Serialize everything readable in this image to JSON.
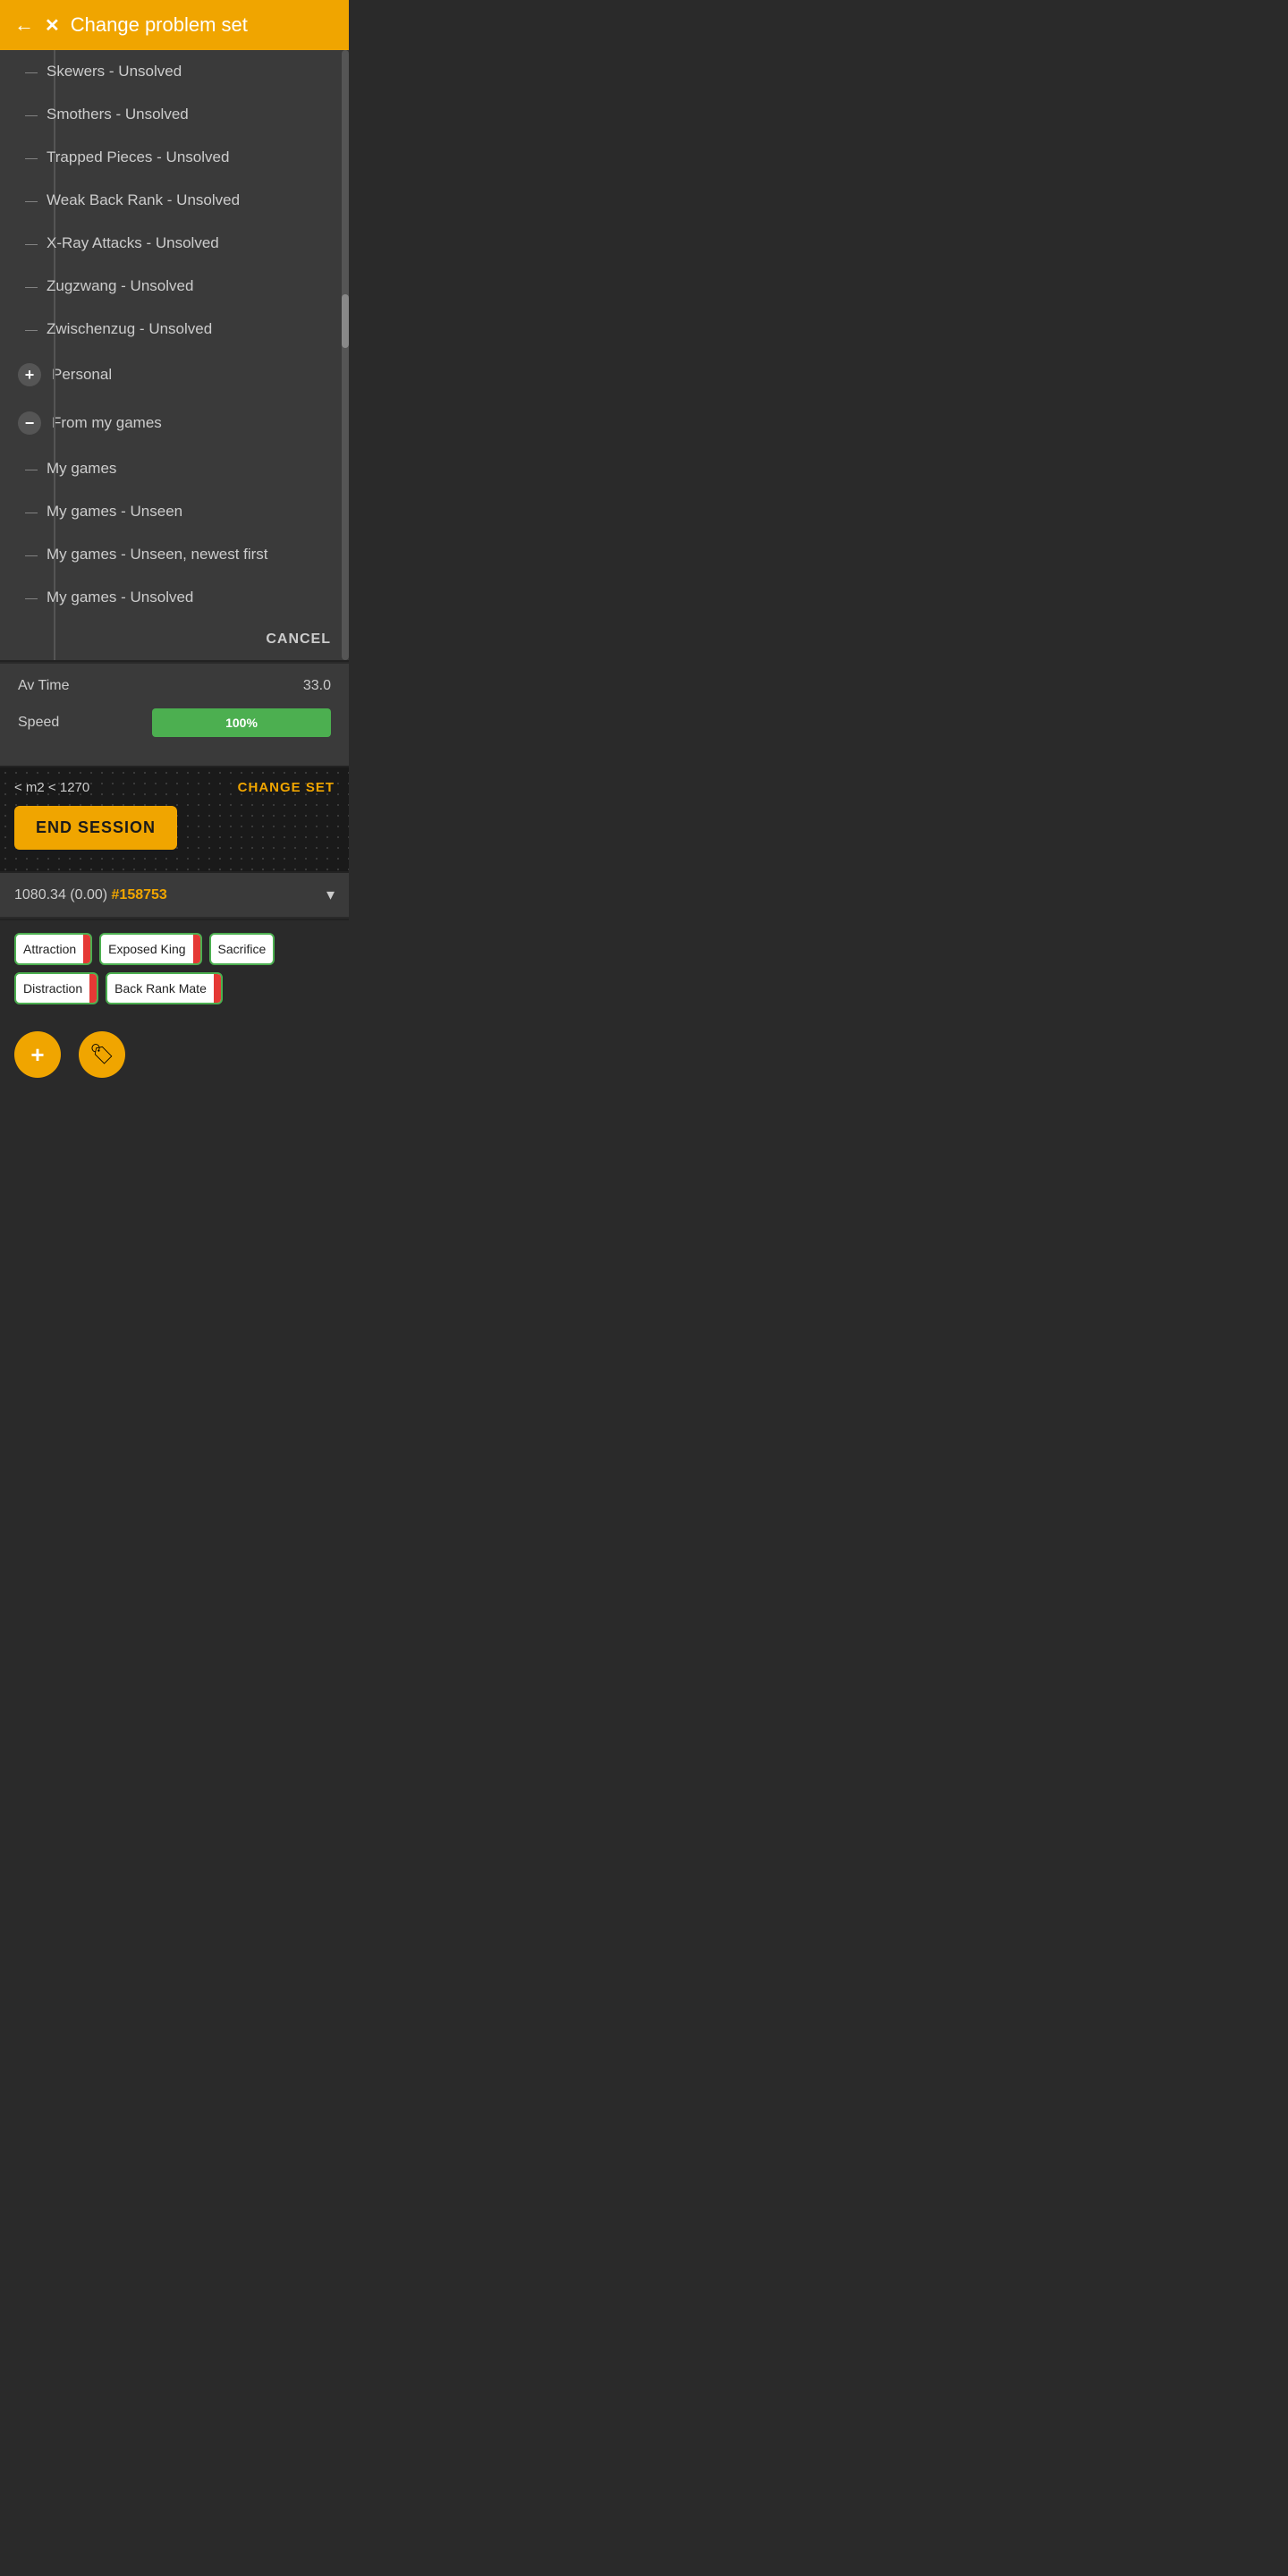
{
  "header": {
    "title": "Change problem set",
    "back_icon": "←",
    "close_icon": "✕"
  },
  "menu": {
    "items_top": [
      {
        "label": "Skewers - Unsolved"
      },
      {
        "label": "Smothers - Unsolved"
      },
      {
        "label": "Trapped Pieces - Unsolved"
      },
      {
        "label": "Weak Back Rank - Unsolved"
      },
      {
        "label": "X-Ray Attacks - Unsolved"
      },
      {
        "label": "Zugzwang - Unsolved"
      },
      {
        "label": "Zwischenzug - Unsolved"
      }
    ],
    "personal_label": "Personal",
    "from_my_games_label": "From my games",
    "sub_items": [
      {
        "label": "My games"
      },
      {
        "label": "My games - Unseen"
      },
      {
        "label": "My games - Unseen, newest first"
      },
      {
        "label": "My games - Unsolved"
      }
    ],
    "cancel_label": "CANCEL"
  },
  "stats": {
    "av_time_label": "Av Time",
    "av_time_value": "33.0",
    "speed_label": "Speed",
    "speed_value": "100%"
  },
  "actions": {
    "rating_text": "< m2 < 1270",
    "change_set_label": "CHANGE SET",
    "end_session_label": "END SESSION"
  },
  "game_info": {
    "score": "1080.34 (0.00)",
    "game_link": "#158753",
    "chevron": "▾"
  },
  "tags": [
    {
      "label": "Attraction",
      "has_indicator": true
    },
    {
      "label": "Exposed King",
      "has_indicator": true
    },
    {
      "label": "Sacrifice",
      "has_indicator": false
    },
    {
      "label": "Distraction",
      "has_indicator": true
    },
    {
      "label": "Back Rank Mate",
      "has_indicator": true
    }
  ],
  "bottom_buttons": {
    "add_icon": "+",
    "tag_icon": "🏷"
  },
  "sidebar": {
    "items": [
      {
        "icon": "☰"
      },
      {
        "icon": "▦"
      }
    ]
  }
}
